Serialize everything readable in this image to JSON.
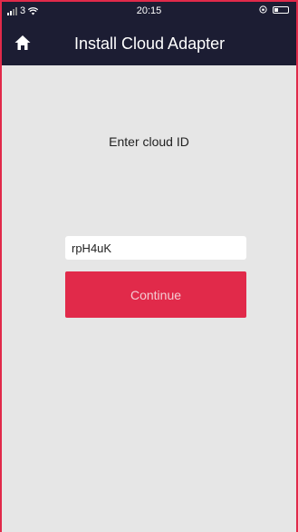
{
  "status_bar": {
    "carrier": "3",
    "time": "20:15"
  },
  "nav": {
    "title": "Install Cloud Adapter",
    "home_icon": "home-icon"
  },
  "main": {
    "prompt": "Enter cloud ID",
    "cloud_id_value": "rpH4uK",
    "continue_label": "Continue"
  },
  "colors": {
    "header_bg": "#1c1d33",
    "accent": "#e12a4a",
    "page_bg": "#e6e6e6"
  }
}
